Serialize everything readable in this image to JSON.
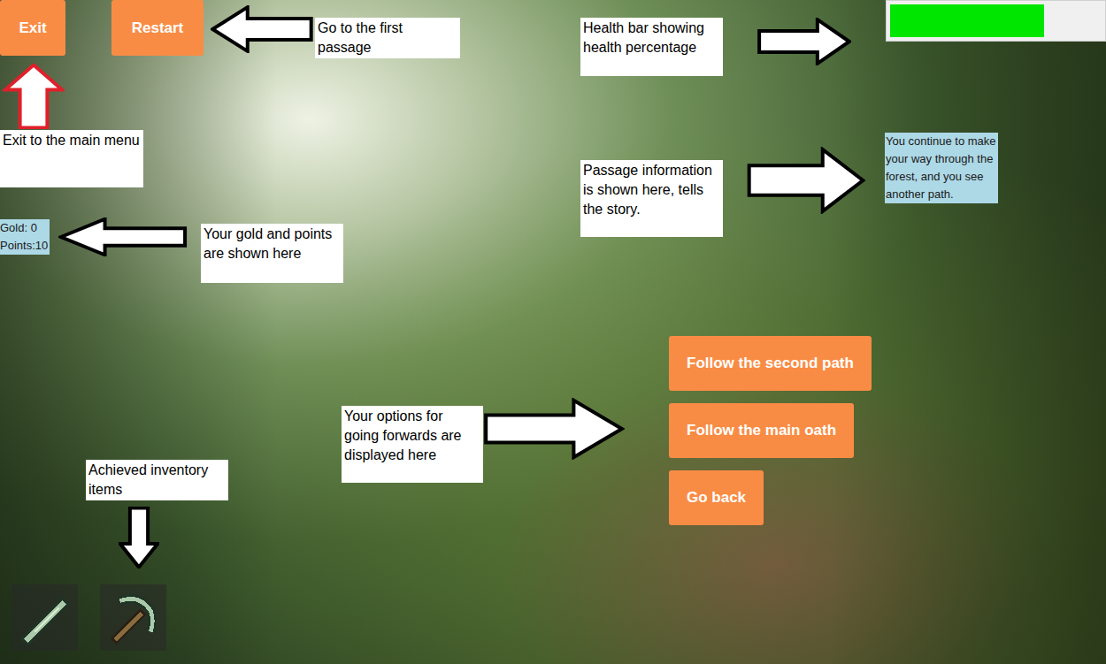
{
  "hud": {
    "exit_button": "Exit",
    "restart_button": "Restart"
  },
  "stats": {
    "gold": "Gold: 0",
    "points": "Points:10"
  },
  "health_bar": {
    "level": 0.73
  },
  "passage": {
    "text": "You continue to make your way through the forest, and you see another path."
  },
  "options": [
    "Follow the second path",
    "Follow the main oath",
    "Go back"
  ],
  "inventory": [
    {
      "kind": "sword"
    },
    {
      "kind": "pickaxe"
    }
  ],
  "annotations": [
    {
      "text": "Go to the first passage",
      "kind": "left",
      "color": "#000000"
    },
    {
      "text": "Exit to the main menu",
      "kind": "up",
      "color": "#e0202a"
    },
    {
      "text": "Your gold and points are shown here",
      "kind": "left",
      "color": "#000000"
    },
    {
      "text": "Health bar showing health percentage",
      "kind": "right",
      "color": "#000000"
    },
    {
      "text": "Passage information is shown here, tells the story.",
      "kind": "right",
      "color": "#000000"
    },
    {
      "text": "Your options for going forwards are displayed here",
      "kind": "right",
      "color": "#000000"
    },
    {
      "text": "Achieved inventory items",
      "kind": "down",
      "color": "#000000"
    }
  ]
}
